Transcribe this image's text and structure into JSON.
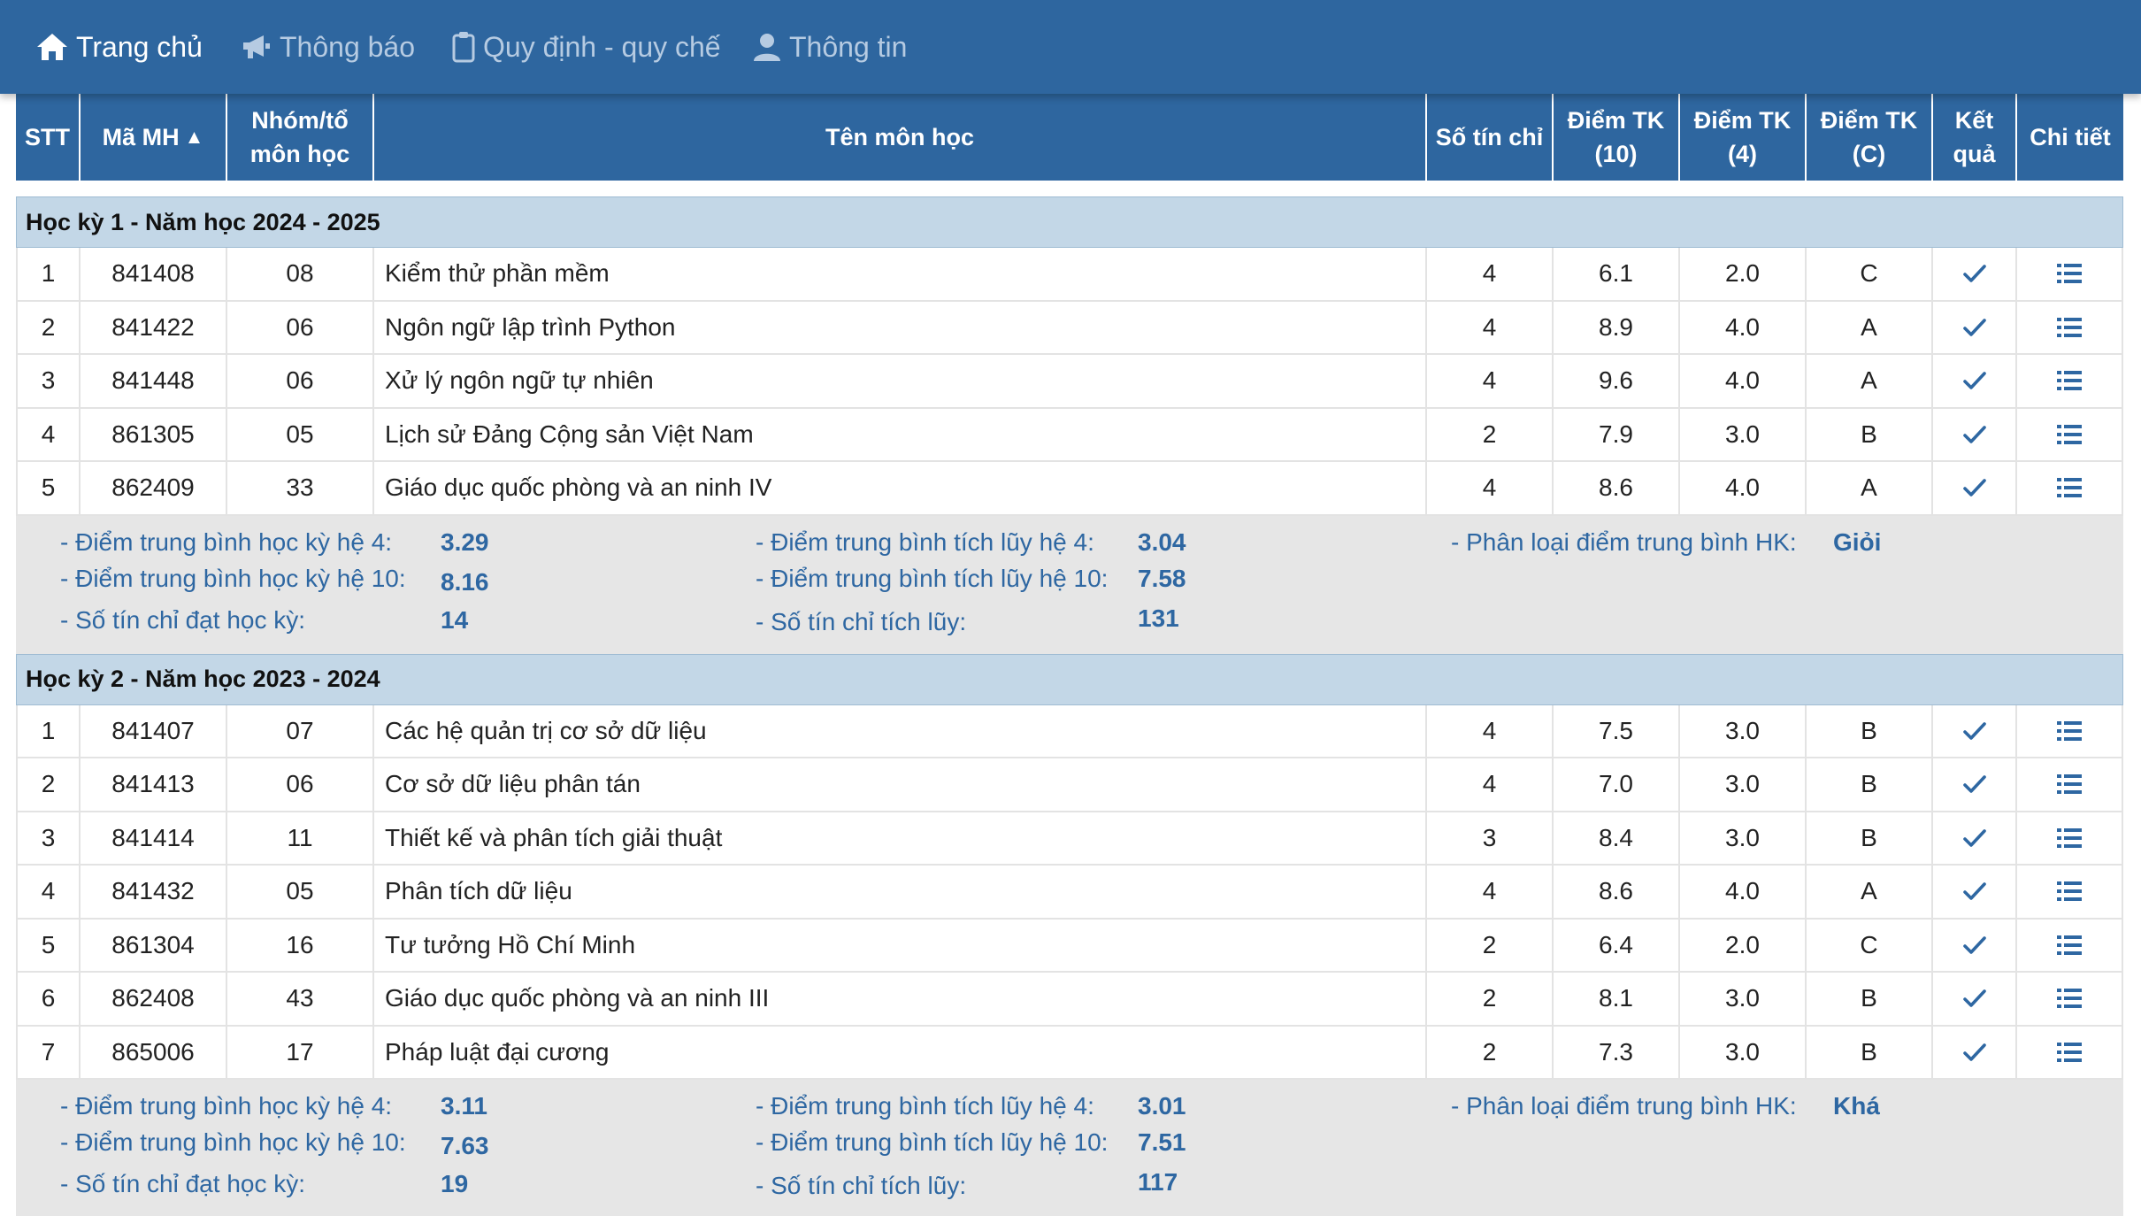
{
  "nav": {
    "items": [
      {
        "label": "Trang chủ",
        "icon": "home-icon",
        "active": true
      },
      {
        "label": "Thông báo",
        "icon": "megaphone-icon",
        "active": false
      },
      {
        "label": "Quy định - quy chế",
        "icon": "clipboard-icon",
        "active": false
      },
      {
        "label": "Thông tin",
        "icon": "user-icon",
        "active": false
      }
    ]
  },
  "table": {
    "columns": {
      "stt": "STT",
      "code": "Mã MH",
      "group_line1": "Nhóm/tổ",
      "group_line2": "môn học",
      "name": "Tên môn học",
      "credits": "Số tín chỉ",
      "score10_line1": "Điểm TK",
      "score10_line2": "(10)",
      "score4_line1": "Điểm TK",
      "score4_line2": "(4)",
      "scoreC_line1": "Điểm TK",
      "scoreC_line2": "(C)",
      "result_line1": "Kết",
      "result_line2": "quả",
      "detail": "Chi tiết"
    },
    "sort_indicator": "▲"
  },
  "semesters": [
    {
      "title": "Học kỳ 1 - Năm học 2024 - 2025",
      "rows": [
        {
          "stt": "1",
          "code": "841408",
          "group": "08",
          "name": "Kiểm thử phần mềm",
          "credits": "4",
          "s10": "6.1",
          "s4": "2.0",
          "sc": "C"
        },
        {
          "stt": "2",
          "code": "841422",
          "group": "06",
          "name": "Ngôn ngữ lập trình Python",
          "credits": "4",
          "s10": "8.9",
          "s4": "4.0",
          "sc": "A"
        },
        {
          "stt": "3",
          "code": "841448",
          "group": "06",
          "name": "Xử lý ngôn ngữ tự nhiên",
          "credits": "4",
          "s10": "9.6",
          "s4": "4.0",
          "sc": "A"
        },
        {
          "stt": "4",
          "code": "861305",
          "group": "05",
          "name": "Lịch sử Đảng Cộng sản Việt Nam",
          "credits": "2",
          "s10": "7.9",
          "s4": "3.0",
          "sc": "B"
        },
        {
          "stt": "5",
          "code": "862409",
          "group": "33",
          "name": "Giáo dục quốc phòng và an ninh IV",
          "credits": "4",
          "s10": "8.6",
          "s4": "4.0",
          "sc": "A"
        }
      ],
      "summary": {
        "gpa4_label": "- Điểm trung bình học kỳ hệ 4:",
        "gpa4": "3.29",
        "gpa10_label": "- Điểm trung bình học kỳ hệ 10:",
        "gpa10": "8.16",
        "credits_label": "- Số tín chỉ đạt học kỳ:",
        "credits": "14",
        "cum4_label": "- Điểm trung bình tích lũy hệ 4:",
        "cum4": "3.04",
        "cum10_label": "- Điểm trung bình tích lũy hệ 10:",
        "cum10": "7.58",
        "cumcredits_label": "- Số tín chỉ tích lũy:",
        "cumcredits": "131",
        "rank_label": "- Phân loại điểm trung bình HK:",
        "rank": "Giỏi"
      }
    },
    {
      "title": "Học kỳ 2 - Năm học 2023 - 2024",
      "rows": [
        {
          "stt": "1",
          "code": "841407",
          "group": "07",
          "name": "Các hệ quản trị cơ sở dữ liệu",
          "credits": "4",
          "s10": "7.5",
          "s4": "3.0",
          "sc": "B"
        },
        {
          "stt": "2",
          "code": "841413",
          "group": "06",
          "name": "Cơ sở dữ liệu phân tán",
          "credits": "4",
          "s10": "7.0",
          "s4": "3.0",
          "sc": "B"
        },
        {
          "stt": "3",
          "code": "841414",
          "group": "11",
          "name": "Thiết kế và phân tích giải thuật",
          "credits": "3",
          "s10": "8.4",
          "s4": "3.0",
          "sc": "B"
        },
        {
          "stt": "4",
          "code": "841432",
          "group": "05",
          "name": "Phân tích dữ liệu",
          "credits": "4",
          "s10": "8.6",
          "s4": "4.0",
          "sc": "A"
        },
        {
          "stt": "5",
          "code": "861304",
          "group": "16",
          "name": "Tư tưởng Hồ Chí Minh",
          "credits": "2",
          "s10": "6.4",
          "s4": "2.0",
          "sc": "C"
        },
        {
          "stt": "6",
          "code": "862408",
          "group": "43",
          "name": "Giáo dục quốc phòng và an ninh III",
          "credits": "2",
          "s10": "8.1",
          "s4": "3.0",
          "sc": "B"
        },
        {
          "stt": "7",
          "code": "865006",
          "group": "17",
          "name": "Pháp luật đại cương",
          "credits": "2",
          "s10": "7.3",
          "s4": "3.0",
          "sc": "B"
        }
      ],
      "summary": {
        "gpa4_label": "- Điểm trung bình học kỳ hệ 4:",
        "gpa4": "3.11",
        "gpa10_label": "- Điểm trung bình học kỳ hệ 10:",
        "gpa10": "7.63",
        "credits_label": "- Số tín chỉ đạt học kỳ:",
        "credits": "19",
        "cum4_label": "- Điểm trung bình tích lũy hệ 4:",
        "cum4": "3.01",
        "cum10_label": "- Điểm trung bình tích lũy hệ 10:",
        "cum10": "7.51",
        "cumcredits_label": "- Số tín chỉ tích lũy:",
        "cumcredits": "117",
        "rank_label": "- Phân loại điểm trung bình HK:",
        "rank": "Khá"
      }
    }
  ],
  "colors": {
    "header_bg": "#2e669f",
    "semester_bg": "#c3d7e7",
    "summary_bg": "#e6e6e6",
    "summary_text": "#2e67a2",
    "icon_blue": "#2e67a2"
  }
}
